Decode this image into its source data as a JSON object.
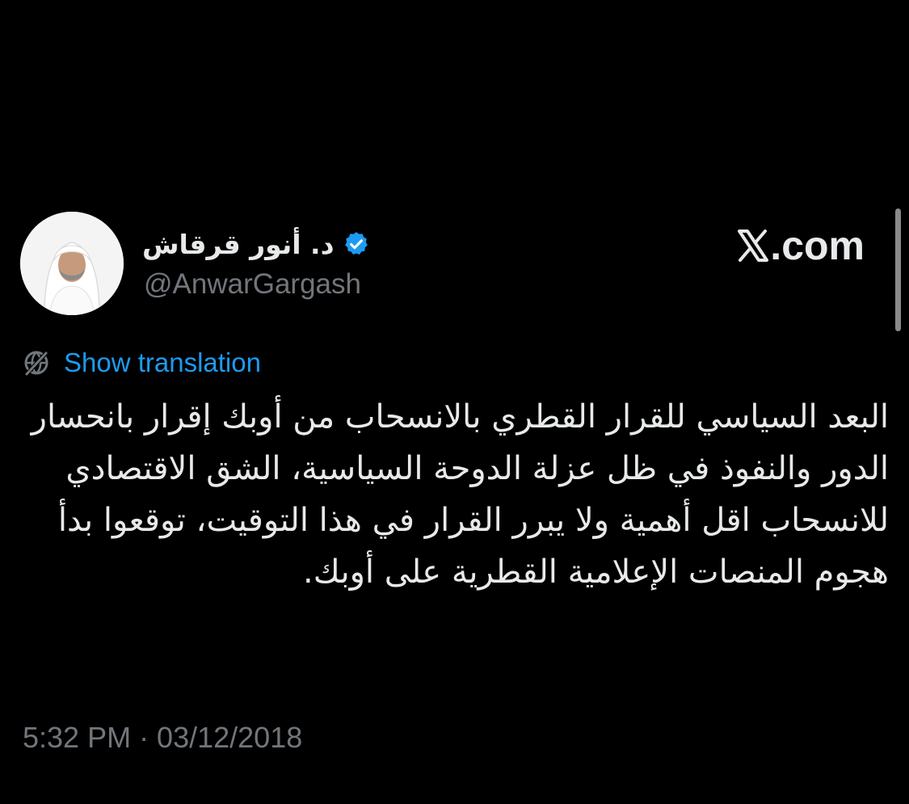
{
  "author": {
    "display_name": "د. أنور قرقاش",
    "handle": "@AnwarGargash",
    "verified_icon": "verified-badge-icon",
    "avatar_icon": "profile-photo"
  },
  "brand": {
    "label": ".com",
    "icon": "x-logo-icon"
  },
  "translate": {
    "icon": "globe-icon",
    "label": "Show translation"
  },
  "tweet": {
    "text": "البعد السياسي للقرار القطري بالانسحاب من أوبك إقرار بانحسار الدور والنفوذ في ظل عزلة الدوحة السياسية، الشق الاقتصادي للانسحاب اقل أهمية ولا يبرر القرار في هذا التوقيت، توقعوا بدأ هجوم المنصات الإعلامية القطرية على أوبك."
  },
  "timestamp": "5:32 PM · 03/12/2018",
  "colors": {
    "background": "#000000",
    "text": "#e7e9ea",
    "muted": "#71767b",
    "link": "#1d9bf0",
    "verified": "#1d9bf0"
  }
}
